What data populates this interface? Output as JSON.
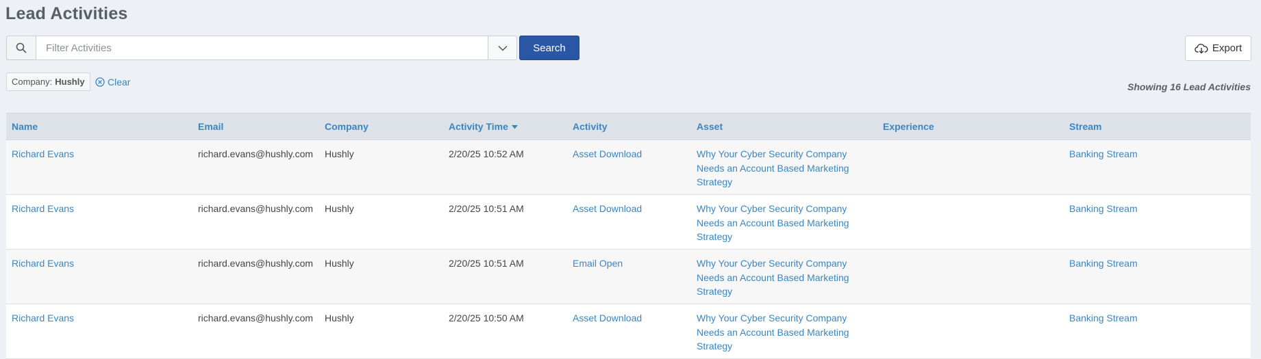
{
  "page": {
    "title": "Lead Activities"
  },
  "search": {
    "placeholder": "Filter Activities",
    "value": "",
    "button_label": "Search"
  },
  "export": {
    "label": "Export"
  },
  "filter": {
    "key": "Company:",
    "value": "Hushly",
    "clear_label": "Clear"
  },
  "summary": {
    "showing": "Showing 16 Lead Activities"
  },
  "colors": {
    "accent": "#3b86c0",
    "primary_button": "#2a56a6",
    "header_bg": "#dde2e9"
  },
  "table": {
    "columns": [
      "Name",
      "Email",
      "Company",
      "Activity Time",
      "Activity",
      "Asset",
      "Experience",
      "Stream"
    ],
    "sorted_column_icon": "caret-down-icon",
    "rows": [
      {
        "name": "Richard Evans",
        "email": "richard.evans@hushly.com",
        "company": "Hushly",
        "time": "2/20/25 10:52 AM",
        "activity": "Asset Download",
        "asset": [
          "Why Your Cyber Security Company",
          "Needs an Account Based Marketing",
          "Strategy"
        ],
        "experience": "",
        "stream": "Banking Stream"
      },
      {
        "name": "Richard Evans",
        "email": "richard.evans@hushly.com",
        "company": "Hushly",
        "time": "2/20/25 10:51 AM",
        "activity": "Asset Download",
        "asset": [
          "Why Your Cyber Security Company",
          "Needs an Account Based Marketing",
          "Strategy"
        ],
        "experience": "",
        "stream": "Banking Stream"
      },
      {
        "name": "Richard Evans",
        "email": "richard.evans@hushly.com",
        "company": "Hushly",
        "time": "2/20/25 10:51 AM",
        "activity": "Email Open",
        "asset": [
          "Why Your Cyber Security Company",
          "Needs an Account Based Marketing",
          "Strategy"
        ],
        "experience": "",
        "stream": "Banking Stream"
      },
      {
        "name": "Richard Evans",
        "email": "richard.evans@hushly.com",
        "company": "Hushly",
        "time": "2/20/25 10:50 AM",
        "activity": "Asset Download",
        "asset": [
          "Why Your Cyber Security Company",
          "Needs an Account Based Marketing",
          "Strategy"
        ],
        "experience": "",
        "stream": "Banking Stream"
      }
    ]
  }
}
